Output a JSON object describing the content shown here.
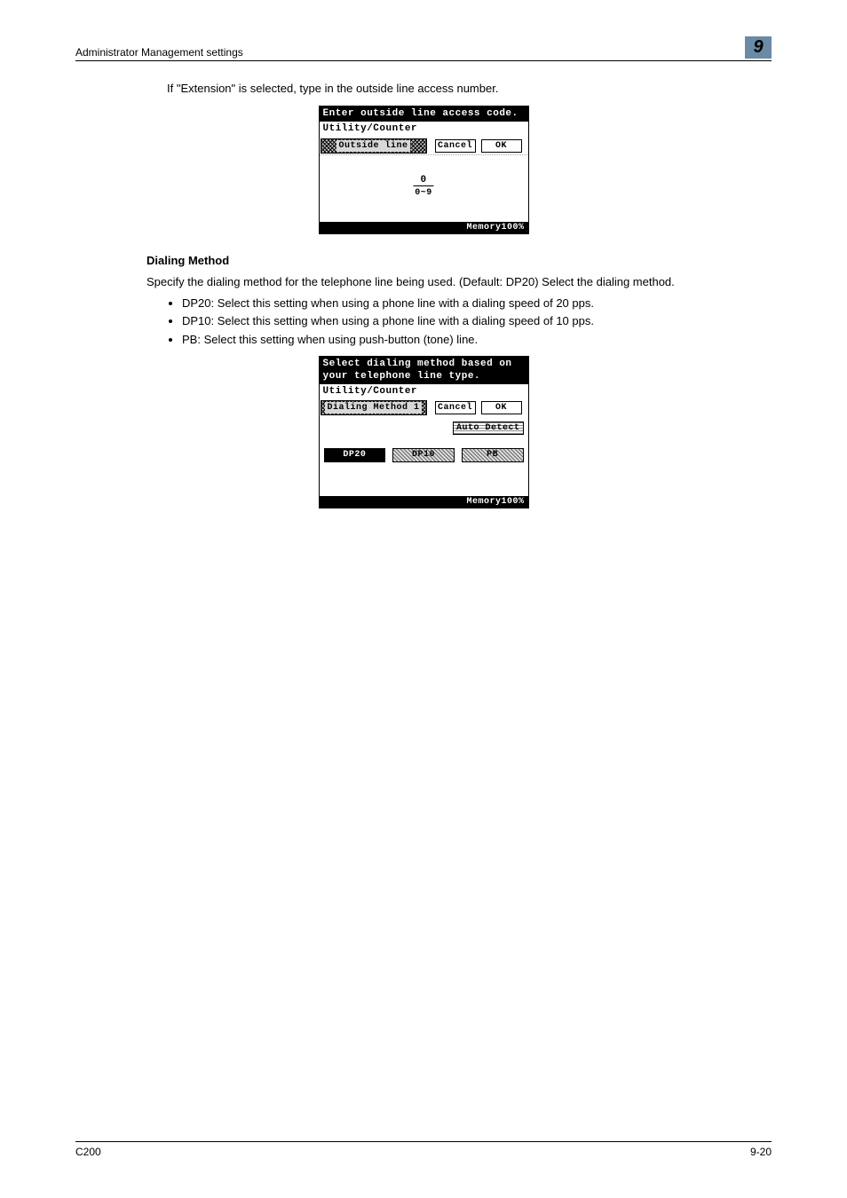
{
  "header": {
    "title": "Administrator Management settings",
    "chapter": "9"
  },
  "intro_text": "If \"Extension\" is selected, type in the outside line access number.",
  "lcd1": {
    "top_text": "Enter outside line access code.",
    "menu_path": "Utility/Counter",
    "tab_label": "Outside line",
    "cancel": "Cancel",
    "ok": "OK",
    "entry_value": "0",
    "entry_range": "0~9",
    "memory": "Memory100%"
  },
  "section": {
    "heading": "Dialing Method",
    "desc": "Specify the dialing method for the telephone line being used. (Default: DP20) Select the dialing method.",
    "bullets": [
      "DP20: Select this setting when using a phone line with a dialing speed of 20 pps.",
      "DP10: Select this setting when using a phone line with a dialing speed of 10 pps.",
      "PB: Select this setting when using push-button (tone) line."
    ]
  },
  "lcd2": {
    "top_text": "Select dialing method based on your telephone line type.",
    "menu_path": "Utility/Counter",
    "tab_label": "Dialing Method 1",
    "cancel": "Cancel",
    "ok": "OK",
    "auto_detect": "Auto Detect",
    "opt1": "DP20",
    "opt2": "DP10",
    "opt3": "PB",
    "memory": "Memory100%"
  },
  "footer": {
    "left": "C200",
    "right": "9-20"
  },
  "chart_data": null
}
